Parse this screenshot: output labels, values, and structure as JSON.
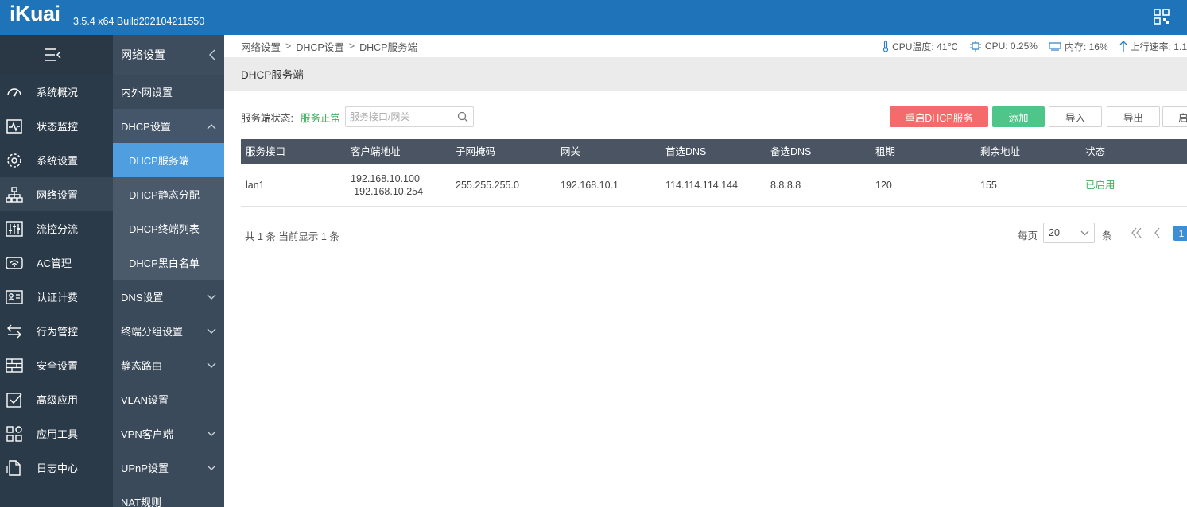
{
  "header": {
    "logo": "iKuai",
    "version": "3.5.4 x64 Build202104211550"
  },
  "sidebar": {
    "items": [
      {
        "label": "系统概况",
        "icon": "dashboard-icon"
      },
      {
        "label": "状态监控",
        "icon": "monitor-pulse-icon"
      },
      {
        "label": "系统设置",
        "icon": "gear-icon"
      },
      {
        "label": "网络设置",
        "icon": "network-icon"
      },
      {
        "label": "流控分流",
        "icon": "sliders-icon"
      },
      {
        "label": "AC管理",
        "icon": "wifi-icon"
      },
      {
        "label": "认证计费",
        "icon": "id-card-icon"
      },
      {
        "label": "行为管控",
        "icon": "arrows-swap-icon"
      },
      {
        "label": "安全设置",
        "icon": "firewall-icon"
      },
      {
        "label": "高级应用",
        "icon": "checkbox-icon"
      },
      {
        "label": "应用工具",
        "icon": "apps-icon"
      },
      {
        "label": "日志中心",
        "icon": "document-icon"
      }
    ]
  },
  "subnav": {
    "title": "网络设置",
    "items": [
      "内外网设置",
      "DHCP设置",
      "DNS设置",
      "终端分组设置",
      "静态路由",
      "VLAN设置",
      "VPN客户端",
      "UPnP设置",
      "NAT规则"
    ],
    "dhcp_children": [
      "DHCP服务端",
      "DHCP静态分配",
      "DHCP终端列表",
      "DHCP黑白名单"
    ]
  },
  "breadcrumb": [
    "网络设置",
    "DHCP设置",
    "DHCP服务端"
  ],
  "breadcrumb_sep": ">",
  "stats": {
    "cpu_temp": "CPU温度: 41℃",
    "cpu": "CPU: 0.25%",
    "memory": "内存: 16%",
    "upload": "上行速率: 1.1"
  },
  "page": {
    "title": "DHCP服务端",
    "service_label": "服务端状态:",
    "service_status": "服务正常",
    "search_placeholder": "服务接口/网关",
    "buttons": {
      "restart": "重启DHCP服务",
      "add": "添加",
      "import": "导入",
      "export": "导出",
      "more": "启"
    }
  },
  "table": {
    "columns": [
      "服务接口",
      "客户端地址",
      "子网掩码",
      "网关",
      "首选DNS",
      "备选DNS",
      "租期",
      "剩余地址",
      "状态"
    ],
    "rows": [
      {
        "interface": "lan1",
        "client_addr_start": "192.168.10.100",
        "client_addr_end": "-192.168.10.254",
        "netmask": "255.255.255.0",
        "gateway": "192.168.10.1",
        "dns1": "114.114.114.144",
        "dns2": "8.8.8.8",
        "lease": "120",
        "remaining": "155",
        "status": "已启用"
      }
    ]
  },
  "pagination": {
    "summary": "共 1 条 当前显示 1 条",
    "per_page_label": "每页",
    "per_page_value": "20",
    "per_page_unit": "条",
    "current_page": "1"
  },
  "colors": {
    "header": "#1f74b9",
    "sidebar": "#2b3a48",
    "active_sub": "#4f9fe0",
    "danger": "#f56a6a",
    "success": "#4fc58a",
    "status_ok": "#3fae5b"
  }
}
